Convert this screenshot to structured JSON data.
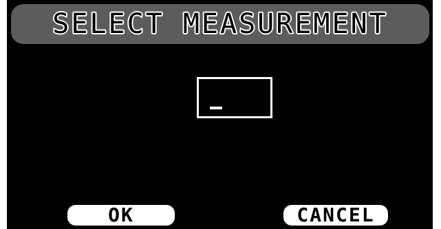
{
  "title": "SELECT MEASUREMENT",
  "entry": {
    "value": "",
    "cursor": "_"
  },
  "softkeys": {
    "ok_label": "OK",
    "cancel_label": "CANCEL"
  },
  "colors": {
    "screen_background": "#000000",
    "title_bar": "#5c5c5c",
    "foreground": "#ffffff"
  }
}
